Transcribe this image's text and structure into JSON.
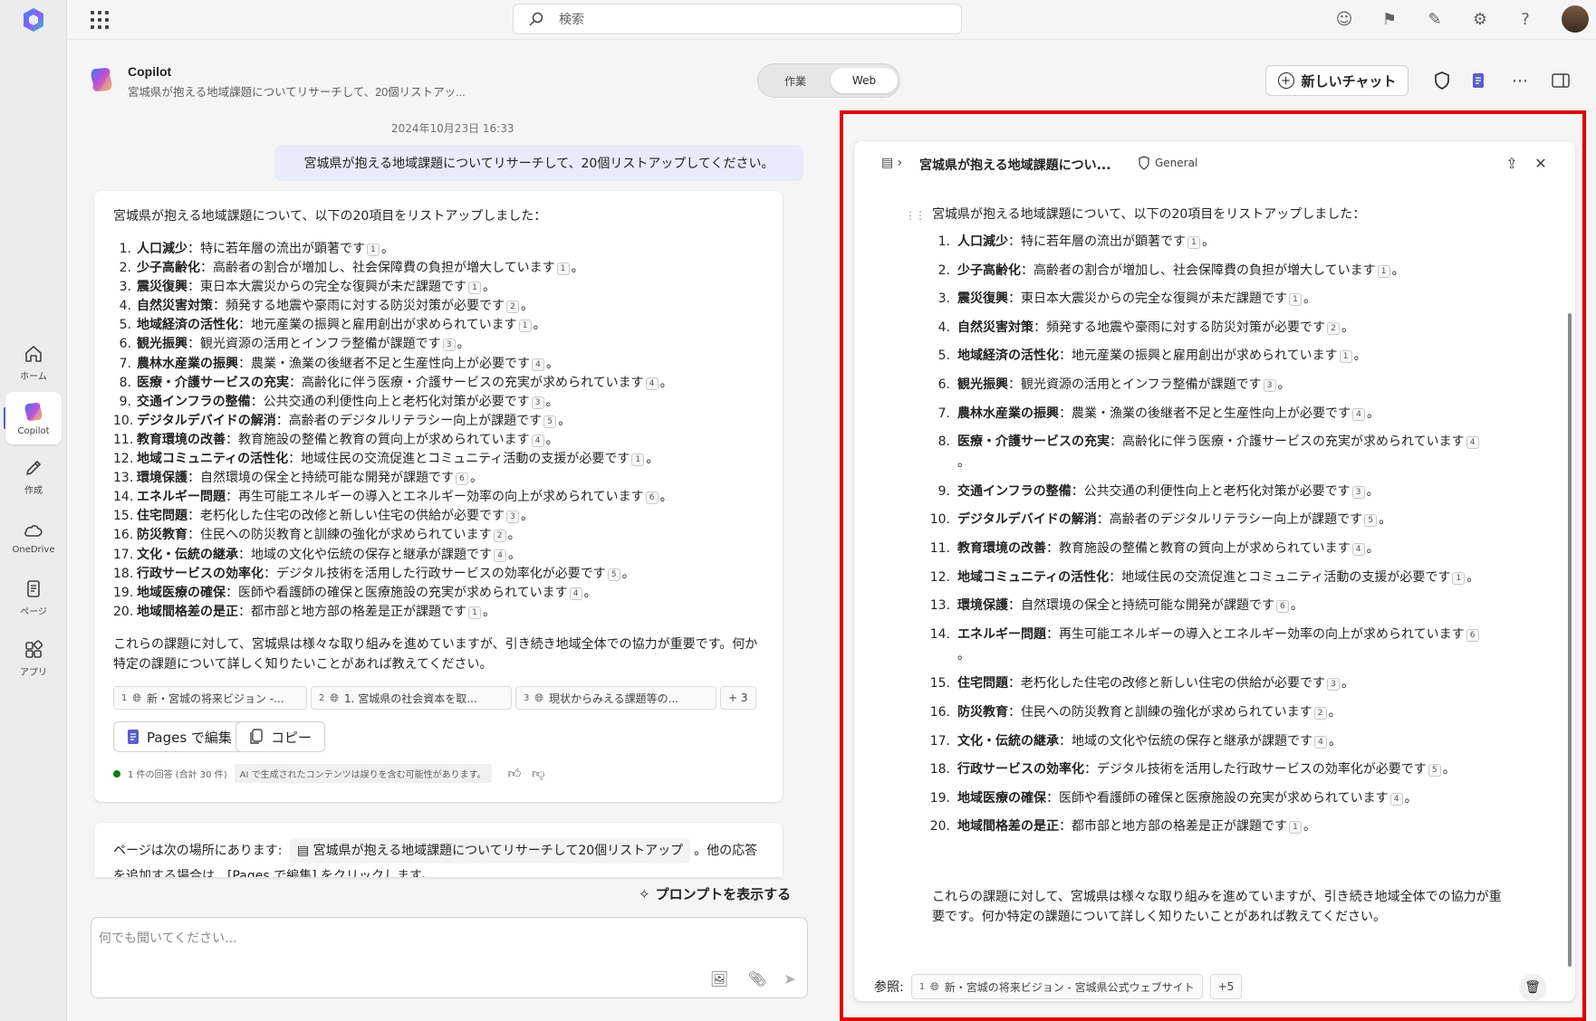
{
  "topbar": {
    "search_placeholder": "検索"
  },
  "rail": {
    "items": [
      {
        "label": "ホーム",
        "icon": "home-icon"
      },
      {
        "label": "Copilot",
        "icon": "copilot-icon"
      },
      {
        "label": "作成",
        "icon": "pen-icon"
      },
      {
        "label": "OneDrive",
        "icon": "cloud-icon"
      },
      {
        "label": "ページ",
        "icon": "page-icon"
      },
      {
        "label": "アプリ",
        "icon": "apps-icon"
      }
    ]
  },
  "header": {
    "title": "Copilot",
    "subtitle": "宮城県が抱える地域課題についてリサーチして、20個リストアッ...",
    "toggle_work": "作業",
    "toggle_web": "Web",
    "new_chat": "新しいチャット"
  },
  "conversation": {
    "timestamp": "2024年10月23日 16:33",
    "user_message": "宮城県が抱える地域課題についてリサーチして、20個リストアップしてください。",
    "intro": "宮城県が抱える地域課題について、以下の20項目をリストアップしました：",
    "items": [
      {
        "n": "1.",
        "term": "人口減少",
        "desc": "：特に若年層の流出が顕著です",
        "cite": "1",
        "tail": "。"
      },
      {
        "n": "2.",
        "term": "少子高齢化",
        "desc": "：高齢者の割合が増加し、社会保障費の負担が増大しています",
        "cite": "1",
        "tail": "。"
      },
      {
        "n": "3.",
        "term": "震災復興",
        "desc": "：東日本大震災からの完全な復興が未だ課題です",
        "cite": "1",
        "tail": "。"
      },
      {
        "n": "4.",
        "term": "自然災害対策",
        "desc": "：頻発する地震や豪雨に対する防災対策が必要です",
        "cite": "2",
        "tail": "。"
      },
      {
        "n": "5.",
        "term": "地域経済の活性化",
        "desc": "：地元産業の振興と雇用創出が求められています",
        "cite": "1",
        "tail": "。"
      },
      {
        "n": "6.",
        "term": "観光振興",
        "desc": "：観光資源の活用とインフラ整備が課題です",
        "cite": "3",
        "tail": "。"
      },
      {
        "n": "7.",
        "term": "農林水産業の振興",
        "desc": "：農業・漁業の後継者不足と生産性向上が必要です",
        "cite": "4",
        "tail": "。"
      },
      {
        "n": "8.",
        "term": "医療・介護サービスの充実",
        "desc": "：高齢化に伴う医療・介護サービスの充実が求められています",
        "cite": "4",
        "tail": "。"
      },
      {
        "n": "9.",
        "term": "交通インフラの整備",
        "desc": "：公共交通の利便性向上と老朽化対策が必要です",
        "cite": "3",
        "tail": "。"
      },
      {
        "n": "10.",
        "term": "デジタルデバイドの解消",
        "desc": "：高齢者のデジタルリテラシー向上が課題です",
        "cite": "5",
        "tail": "。"
      },
      {
        "n": "11.",
        "term": "教育環境の改善",
        "desc": "：教育施設の整備と教育の質向上が求められています",
        "cite": "4",
        "tail": "。"
      },
      {
        "n": "12.",
        "term": "地域コミュニティの活性化",
        "desc": "：地域住民の交流促進とコミュニティ活動の支援が必要です",
        "cite": "1",
        "tail": "。"
      },
      {
        "n": "13.",
        "term": "環境保護",
        "desc": "：自然環境の保全と持続可能な開発が課題です",
        "cite": "6",
        "tail": "。"
      },
      {
        "n": "14.",
        "term": "エネルギー問題",
        "desc": "：再生可能エネルギーの導入とエネルギー効率の向上が求められています",
        "cite": "6",
        "tail": "。"
      },
      {
        "n": "15.",
        "term": "住宅問題",
        "desc": "：老朽化した住宅の改修と新しい住宅の供給が必要です",
        "cite": "3",
        "tail": "。"
      },
      {
        "n": "16.",
        "term": "防災教育",
        "desc": "：住民への防災教育と訓練の強化が求められています",
        "cite": "2",
        "tail": "。"
      },
      {
        "n": "17.",
        "term": "文化・伝統の継承",
        "desc": "：地域の文化や伝統の保存と継承が課題です",
        "cite": "4",
        "tail": "。"
      },
      {
        "n": "18.",
        "term": "行政サービスの効率化",
        "desc": "：デジタル技術を活用した行政サービスの効率化が必要です",
        "cite": "5",
        "tail": "。"
      },
      {
        "n": "19.",
        "term": "地域医療の確保",
        "desc": "：医師や看護師の確保と医療施設の充実が求められています",
        "cite": "4",
        "tail": "。"
      },
      {
        "n": "20.",
        "term": "地域間格差の是正",
        "desc": "：都市部と地方部の格差是正が課題です",
        "cite": "1",
        "tail": "。"
      }
    ],
    "outro": "これらの課題に対して、宮城県は様々な取り組みを進めていますが、引き続き地域全体での協力が重要です。何か特定の課題について詳しく知りたいことがあれば教えてください。",
    "refs": [
      {
        "n": "1",
        "label": "新・宮城の将来ビジョン -..."
      },
      {
        "n": "2",
        "label": "1. 宮城県の社会資本を取..."
      },
      {
        "n": "3",
        "label": "現状からみえる課題等の..."
      }
    ],
    "refs_more": "+ 3",
    "edit_pages": "Pages で編集",
    "copy": "コピー",
    "response_count": "1 件の回答 (合計 30 件)",
    "disclaimer": "AI で生成されたコンテンツは誤りを含む可能性があります。",
    "pages_prefix": "ページは次の場所にあります:",
    "pages_link": "宮城県が抱える地域課題についてリサーチして20個リストアップ",
    "pages_suffix": "。他の応答を追加する場合は、[Pages で編集] をクリックします。",
    "show_prompts": "プロンプトを表示する",
    "input_placeholder": "何でも聞いてください..."
  },
  "panel": {
    "title": "宮城県が抱える地域課題につい...",
    "sensitivity": "General",
    "intro": "宮城県が抱える地域課題について、以下の20項目をリストアップしました：",
    "outro": "これらの課題に対して、宮城県は様々な取り組みを進めていますが、引き続き地域全体での協力が重要です。何か特定の課題について詳しく知りたいことがあれば教えてください。",
    "refs_label": "参照:",
    "ref_n": "1",
    "ref_label": "新・宮城の将来ビジョン - 宮城県公式ウェブサイト",
    "refs_more": "+5"
  },
  "colors": {
    "accent": "#5b5fc7",
    "highlight_frame": "#e00000",
    "user_bubble": "#e8ebfa"
  }
}
